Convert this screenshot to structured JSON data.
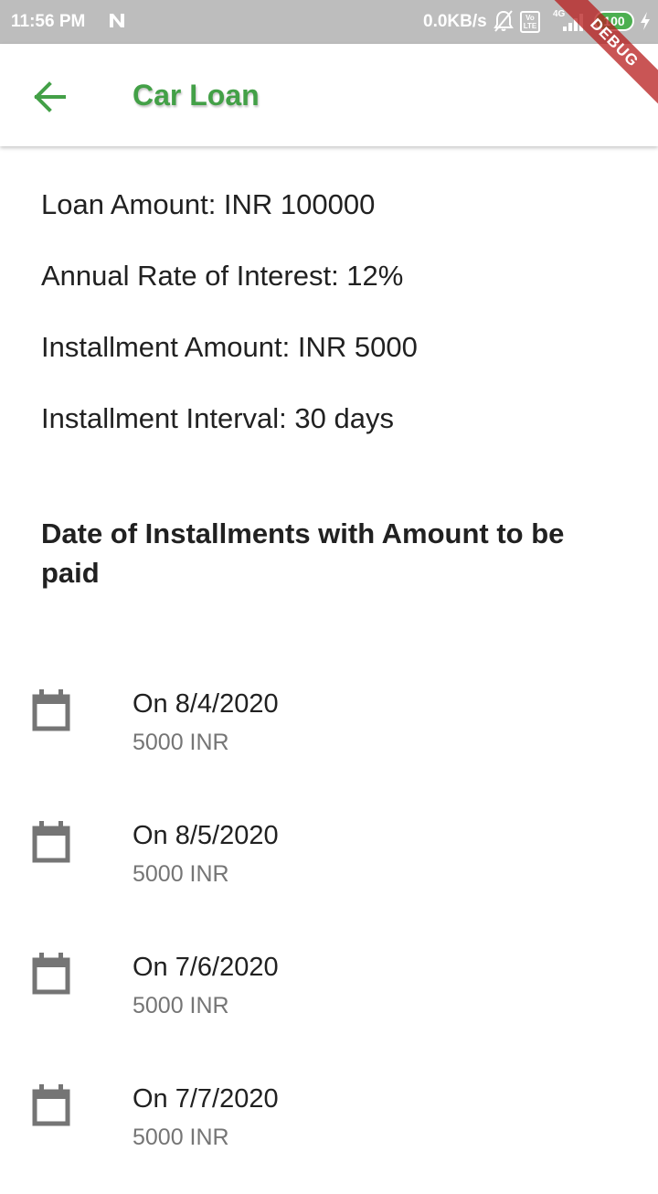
{
  "status_bar": {
    "time": "11:56 PM",
    "speed": "0.0KB/s",
    "volte": "Vo LTE",
    "network": "4G",
    "battery": "100"
  },
  "debug_banner": "DEBUG",
  "app_bar": {
    "title": "Car Loan",
    "accent_color": "#43a047"
  },
  "loan_info": {
    "loan_amount": "Loan Amount: INR 100000",
    "interest_rate": "Annual Rate of Interest: 12%",
    "installment_amount": "Installment Amount: INR 5000",
    "installment_interval": "Installment Interval: 30 days"
  },
  "schedule_heading": "Date of Installments with Amount to be paid",
  "installments": [
    {
      "date": "On 8/4/2020",
      "amount": "5000 INR",
      "icon": "calendar-icon"
    },
    {
      "date": "On 8/5/2020",
      "amount": "5000 INR",
      "icon": "calendar-icon"
    },
    {
      "date": "On 7/6/2020",
      "amount": "5000 INR",
      "icon": "calendar-icon"
    },
    {
      "date": "On 7/7/2020",
      "amount": "5000 INR",
      "icon": "calendar-icon"
    }
  ]
}
